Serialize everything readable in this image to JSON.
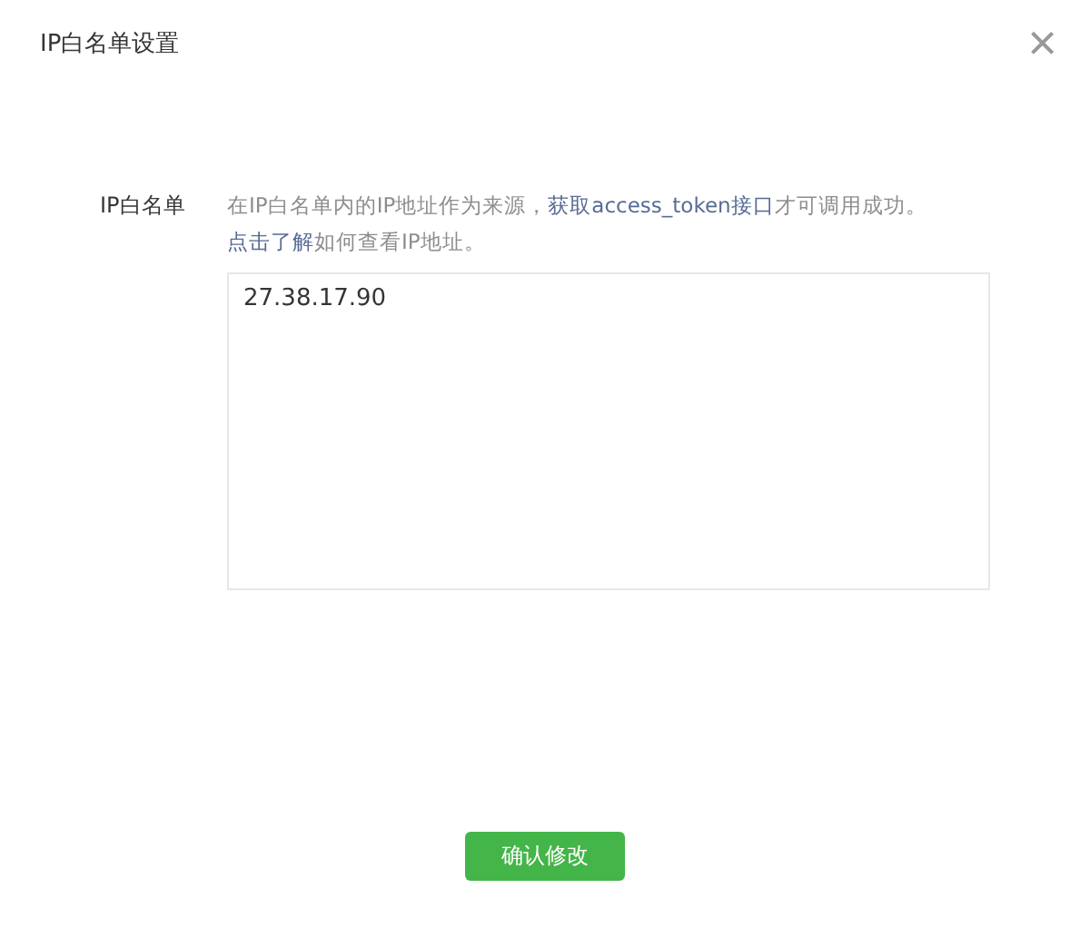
{
  "dialog": {
    "title": "IP白名单设置",
    "close": "×"
  },
  "field": {
    "label": "IP白名单",
    "description": [
      {
        "kind": "text",
        "text": "在IP白名单内的IP地址作为来源，"
      },
      {
        "kind": "link",
        "text": "获取access_token接口"
      },
      {
        "kind": "text",
        "text": "才可调用成功。"
      },
      {
        "kind": "link",
        "text": "点击了解"
      },
      {
        "kind": "text",
        "text": "如何查看IP地址。"
      }
    ],
    "value": "27.38.17.90"
  },
  "buttons": [
    "确认修改"
  ]
}
